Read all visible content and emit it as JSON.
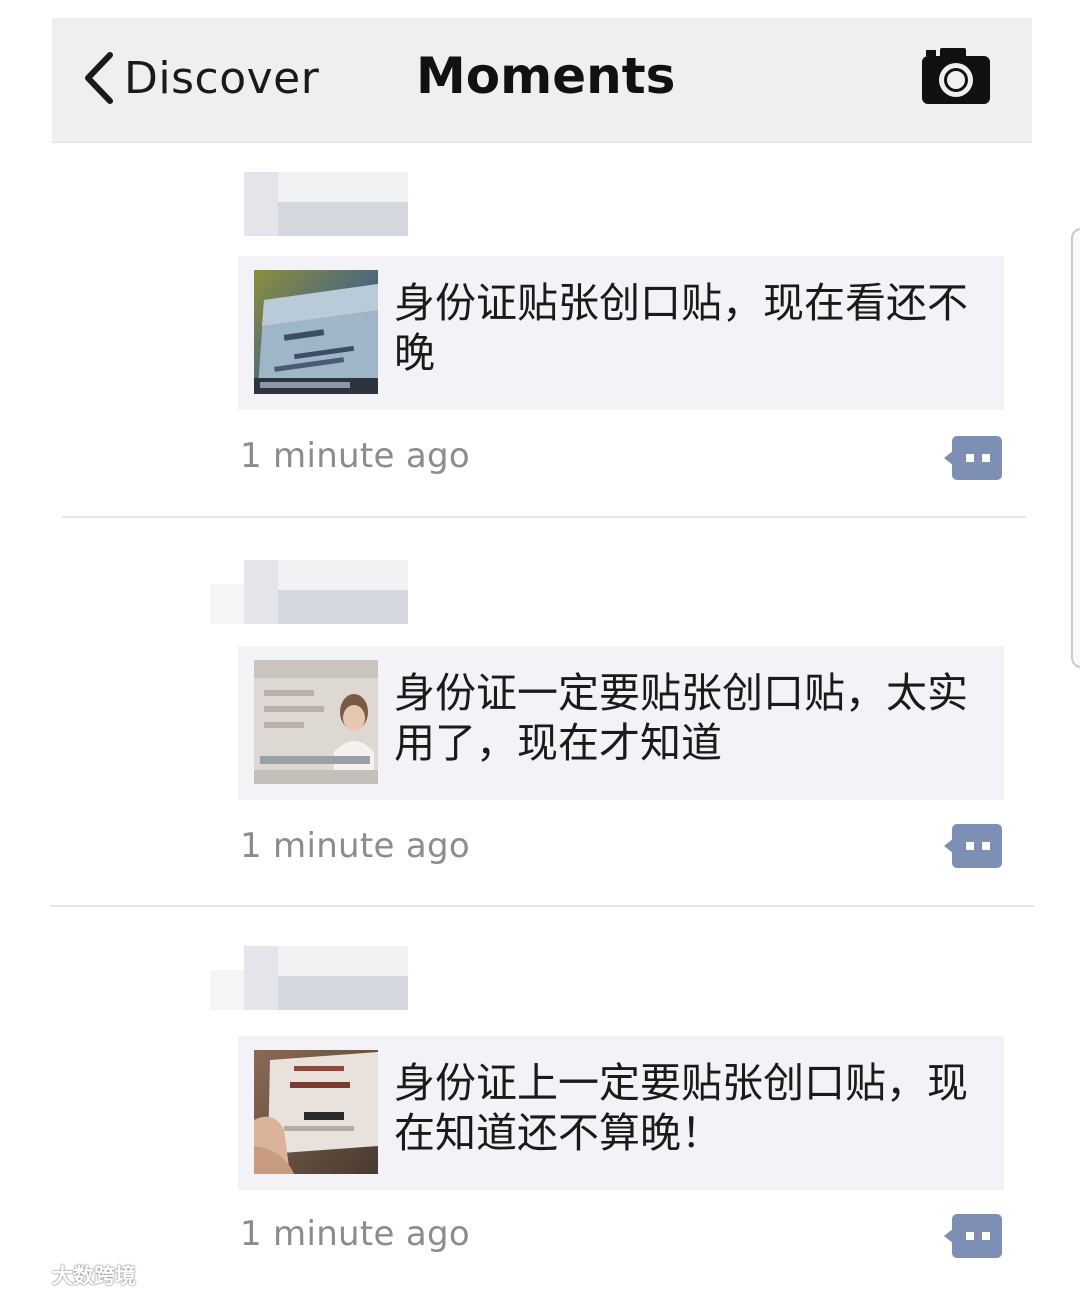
{
  "nav": {
    "back_label": "Discover",
    "title": "Moments",
    "camera_icon": "camera-icon",
    "back_icon": "chevron-left-icon"
  },
  "moments": [
    {
      "text": "身份证贴张创口贴，现在看还不晚",
      "time": "1 minute ago",
      "thumb_icon": "id-card-photo"
    },
    {
      "text": "身份证一定要贴张创口贴，太实用了，现在才知道",
      "time": "1 minute ago",
      "thumb_icon": "id-card-portrait-photo"
    },
    {
      "text": "身份证上一定要贴张创口贴，现在知道还不算晚！",
      "time": "1 minute ago",
      "thumb_icon": "id-card-hand-photo"
    }
  ],
  "colors": {
    "nav_background": "#efefef",
    "card_background": "#f3f2f6",
    "comment_icon": "#7d8fb5",
    "time_text": "#8c8c8c"
  },
  "watermark": {
    "text": "大数跨境"
  }
}
